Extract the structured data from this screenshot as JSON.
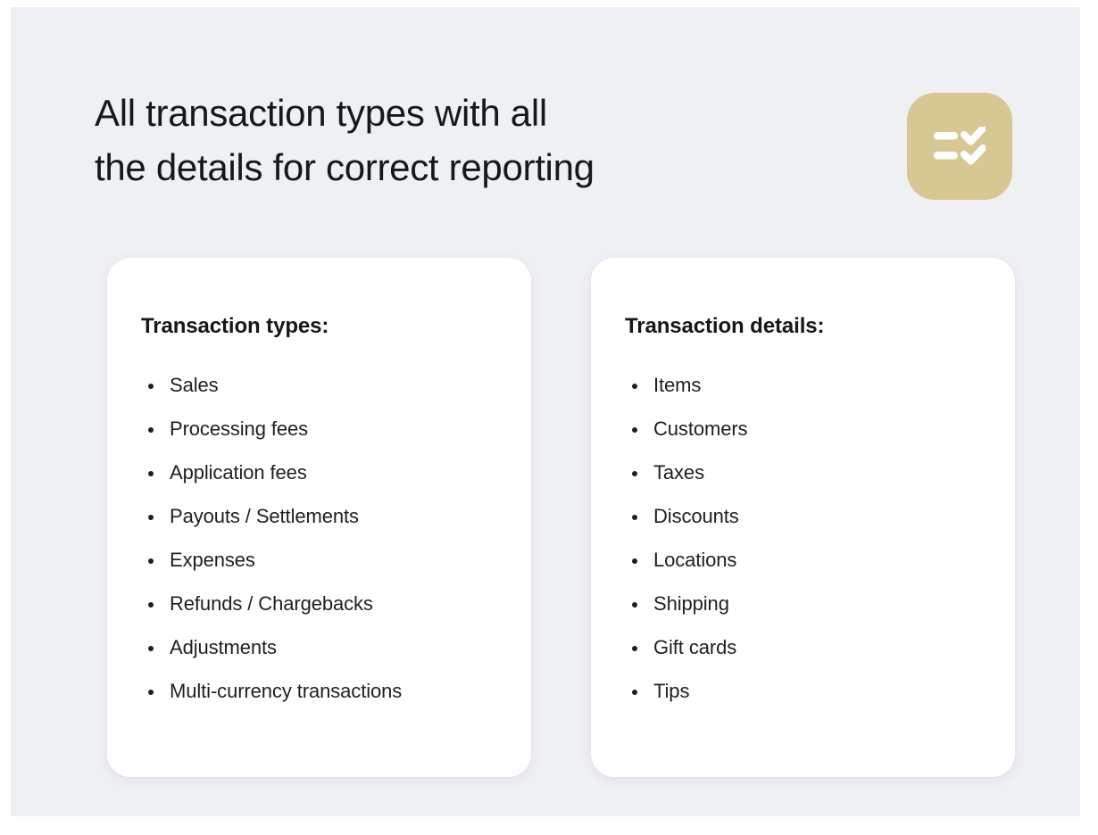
{
  "page": {
    "background_color": "#eef0f4",
    "surface_color": "#ffffff"
  },
  "header": {
    "title": "All transaction types with all\nthe details for correct reporting",
    "badge": {
      "icon": "checklist-icon",
      "background_color": "#d7c893",
      "mark_color": "#ffffff"
    }
  },
  "cards": [
    {
      "title": "Transaction types:",
      "items": [
        "Sales",
        "Processing fees",
        "Application fees",
        "Payouts / Settlements",
        "Expenses",
        "Refunds / Chargebacks",
        "Adjustments",
        "Multi-currency transactions"
      ]
    },
    {
      "title": "Transaction details:",
      "items": [
        "Items",
        "Customers",
        "Taxes",
        "Discounts",
        "Locations",
        "Shipping",
        "Gift cards",
        "Tips"
      ]
    }
  ]
}
